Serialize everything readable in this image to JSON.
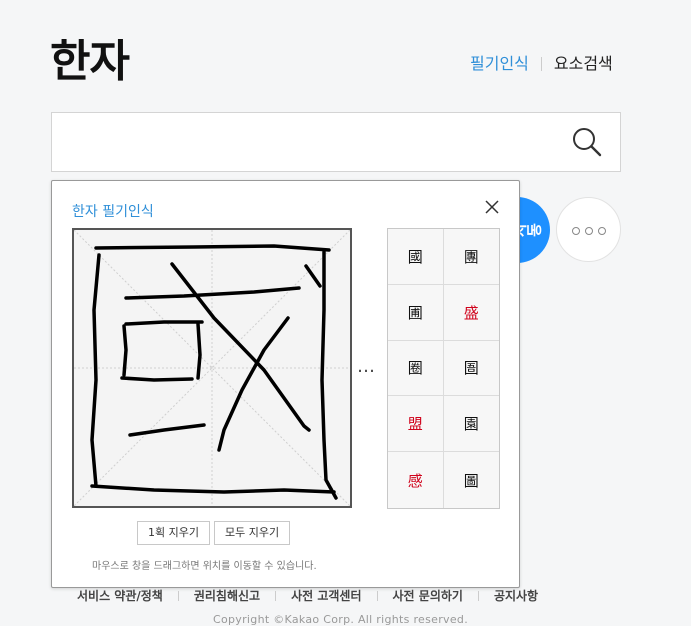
{
  "page": {
    "title": "한자"
  },
  "top_links": {
    "handwriting": "필기인식",
    "element_search": "요소검색"
  },
  "search": {
    "value": "",
    "placeholder": "",
    "icon": "search-icon"
  },
  "side_buttons": {
    "blue_label": "자동",
    "more_icon": "more-icon"
  },
  "popup": {
    "title": "한자 필기인식",
    "ellipsis": "…",
    "candidates": [
      {
        "char": "國",
        "color": "#111111"
      },
      {
        "char": "團",
        "color": "#111111"
      },
      {
        "char": "圃",
        "color": "#111111"
      },
      {
        "char": "盛",
        "color": "#d0021b"
      },
      {
        "char": "圈",
        "color": "#111111"
      },
      {
        "char": "圄",
        "color": "#111111"
      },
      {
        "char": "盟",
        "color": "#d0021b"
      },
      {
        "char": "園",
        "color": "#111111"
      },
      {
        "char": "感",
        "color": "#d0021b"
      },
      {
        "char": "圖",
        "color": "#111111"
      }
    ],
    "undo_label": "1획 지우기",
    "clear_label": "모두 지우기",
    "help_text": "마우스로 창을 드래그하면 위치를 이동할 수 있습니다."
  },
  "footer": {
    "links": [
      "서비스 약관/정책",
      "권리침해신고",
      "사전 고객센터",
      "사전 문의하기",
      "공지사항"
    ],
    "copyright": "Copyright ©Kakao Corp. All rights reserved."
  }
}
